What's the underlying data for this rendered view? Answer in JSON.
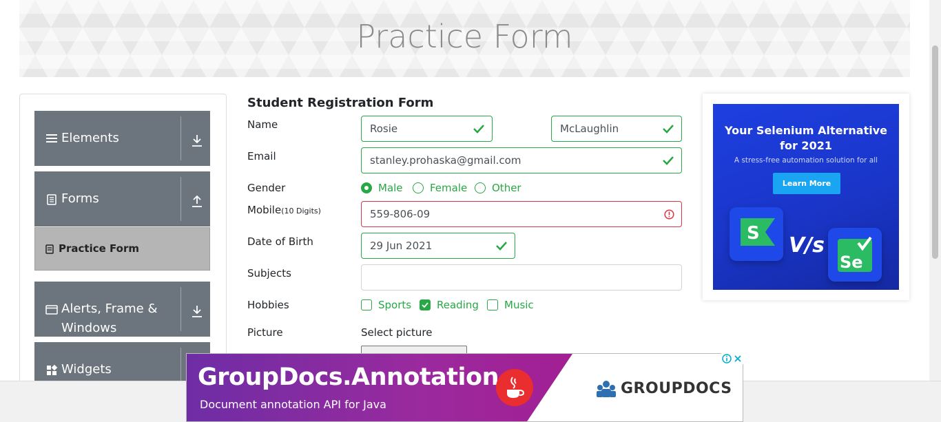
{
  "header": {
    "title": "Practice Form"
  },
  "sidebar": {
    "groups": [
      {
        "label": "Elements",
        "icon": "bars-icon",
        "arrow": "download-arrow-icon"
      },
      {
        "label": "Forms",
        "icon": "document-icon",
        "arrow": "upload-arrow-icon"
      },
      {
        "label": "Alerts, Frame &",
        "label2": "Windows",
        "icon": "window-icon",
        "arrow": "download-arrow-icon"
      },
      {
        "label": "Widgets",
        "icon": "widgets-icon",
        "arrow": "download-arrow-icon"
      }
    ],
    "active_item": {
      "label": "Practice Form",
      "icon": "form-icon"
    }
  },
  "form": {
    "title": "Student Registration Form",
    "labels": {
      "name": "Name",
      "email": "Email",
      "gender": "Gender",
      "mobile": "Mobile",
      "mobile_hint": "(10 Digits)",
      "dob": "Date of Birth",
      "subjects": "Subjects",
      "hobbies": "Hobbies",
      "picture": "Picture"
    },
    "first_name": "Rosie",
    "last_name": "McLaughlin",
    "email": "stanley.prohaska@gmail.com",
    "gender_options": [
      "Male",
      "Female",
      "Other"
    ],
    "gender_selected": "Male",
    "mobile": "559-806-09",
    "dob": "29 Jun 2021",
    "subjects": "",
    "hobbies": [
      {
        "label": "Sports",
        "checked": false
      },
      {
        "label": "Reading",
        "checked": true
      },
      {
        "label": "Music",
        "checked": false
      }
    ],
    "select_picture": "Select picture",
    "colors": {
      "valid": "#28a745",
      "invalid": "#dc3545"
    }
  },
  "ad_right": {
    "headline1": "Your Selenium Alternative",
    "headline2": "for 2021",
    "sub": "A stress-free automation solution for all",
    "cta": "Learn More",
    "vs": "V/s",
    "logo_left": "S",
    "logo_right": "Se"
  },
  "ad_bottom": {
    "title": "GroupDocs.Annotation",
    "subtitle": "Document annotation API for Java",
    "brand": "GROUPDOCS"
  }
}
